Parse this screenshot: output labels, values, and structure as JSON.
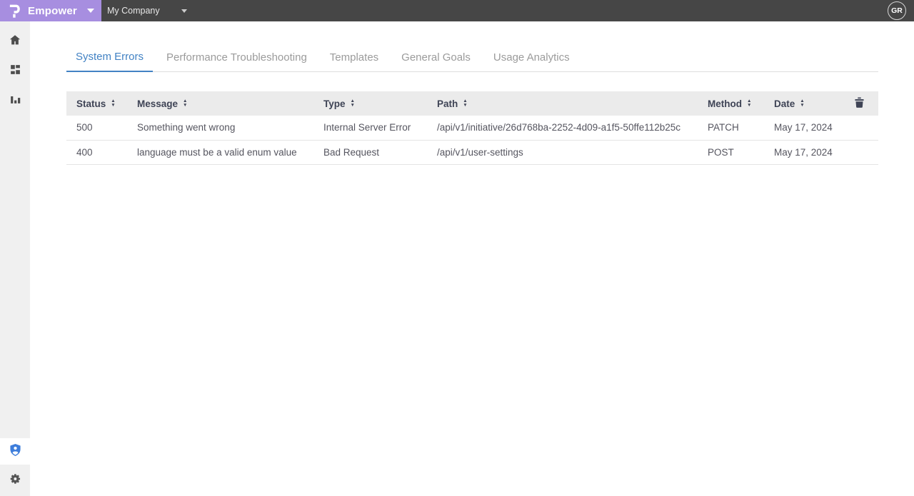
{
  "topbar": {
    "brand": "Empower",
    "company_selector_value": "My Company",
    "avatar_initials": "GR"
  },
  "sidebar": {
    "items": [
      {
        "id": "home",
        "icon": "home-icon"
      },
      {
        "id": "dashboard",
        "icon": "dashboard-icon"
      },
      {
        "id": "reports",
        "icon": "bar-chart-icon"
      }
    ],
    "bottom_items": [
      {
        "id": "admin",
        "icon": "shield-user-icon",
        "active": true
      },
      {
        "id": "settings",
        "icon": "gear-icon"
      }
    ]
  },
  "tabs": [
    {
      "label": "System Errors",
      "active": true
    },
    {
      "label": "Performance Troubleshooting",
      "active": false
    },
    {
      "label": "Templates",
      "active": false
    },
    {
      "label": "General Goals",
      "active": false
    },
    {
      "label": "Usage Analytics",
      "active": false
    }
  ],
  "table": {
    "columns": [
      "Status",
      "Message",
      "Type",
      "Path",
      "Method",
      "Date"
    ],
    "rows": [
      {
        "status": "500",
        "message": "Something went wrong",
        "type": "Internal Server Error",
        "path": "/api/v1/initiative/26d768ba-2252-4d09-a1f5-50ffe112b25c",
        "method": "PATCH",
        "date": "May 17, 2024"
      },
      {
        "status": "400",
        "message": "language must be a valid enum value",
        "type": "Bad Request",
        "path": "/api/v1/user-settings",
        "method": "POST",
        "date": "May 17, 2024"
      }
    ]
  },
  "colors": {
    "brand_purple": "#a78ee0",
    "topbar_dark": "#464646",
    "active_tab_blue": "#4282c4",
    "sidebar_gray": "#f0f0f0",
    "table_header_bg": "#ebebeb",
    "header_text": "#3e4355",
    "shield_blue": "#3d7ddb"
  }
}
